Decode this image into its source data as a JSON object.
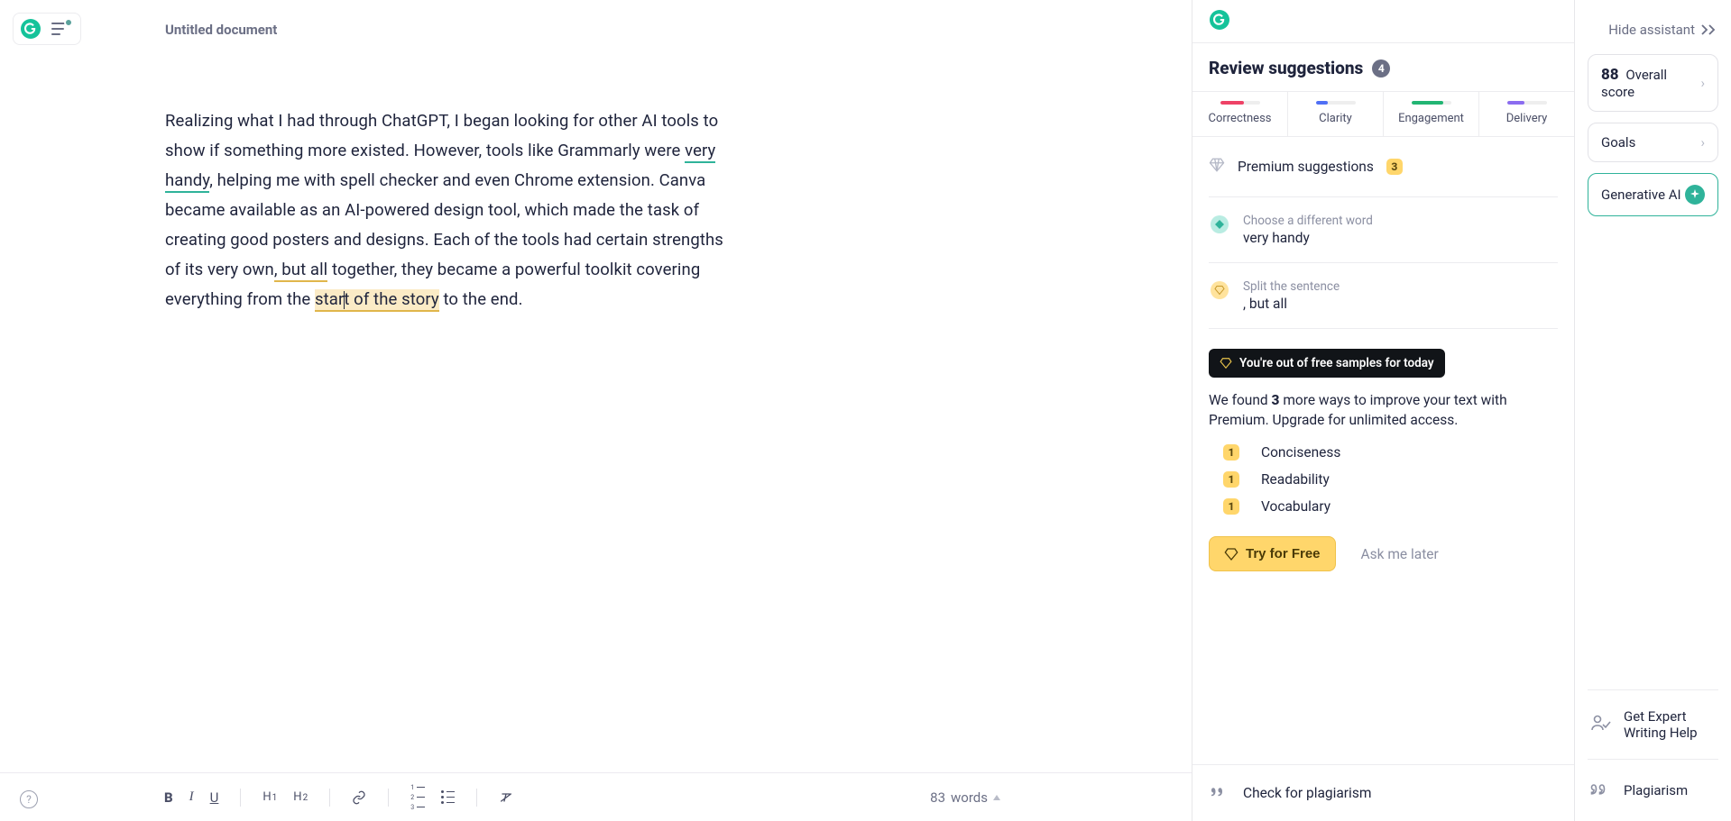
{
  "document": {
    "title": "Untitled document",
    "p1": "Realizing what I had through ChatGPT, I began looking for other AI tools to show if something more existed. However, tools like Grammarly were ",
    "underline1": "very handy",
    "p2": ", helping me with spell checker and even Chrome extension. Canva became available as an AI-powered design tool, which made the task of creating good posters and designs. Each of the tools had certain strengths of its very own",
    "underline2": ", but all",
    "p3": " together, they became a powerful toolkit covering everything from the ",
    "hl_a": "star",
    "hl_b": "t of the story",
    "p4": " to the end."
  },
  "footer": {
    "wordcount_num": "83",
    "wordcount_label": "words"
  },
  "suggestions": {
    "title": "Review suggestions",
    "count": "4",
    "tabs": {
      "correctness": "Correctness",
      "clarity": "Clarity",
      "engagement": "Engagement",
      "delivery": "Delivery"
    },
    "premium_label": "Premium suggestions",
    "premium_count": "3",
    "items": [
      {
        "hint": "Choose a different word",
        "text": "very handy"
      },
      {
        "hint": "Split the sentence",
        "text": ", but all"
      }
    ],
    "samples_chip": "You're out of free samples for today",
    "found_pre": "We found ",
    "found_num": "3",
    "found_post": " more ways to improve your text with Premium. Upgrade for unlimited access.",
    "upsell": [
      {
        "count": "1",
        "label": "Conciseness"
      },
      {
        "count": "1",
        "label": "Readability"
      },
      {
        "count": "1",
        "label": "Vocabulary"
      }
    ],
    "try_label": "Try for Free",
    "ask_later": "Ask me later",
    "plagiarism": "Check for plagiarism"
  },
  "rail": {
    "hide": "Hide assistant",
    "score_num": "88",
    "score_label": "Overall score",
    "goals": "Goals",
    "genai": "Generative AI",
    "expert_l1": "Get Expert",
    "expert_l2": "Writing Help",
    "plagiarism": "Plagiarism"
  }
}
